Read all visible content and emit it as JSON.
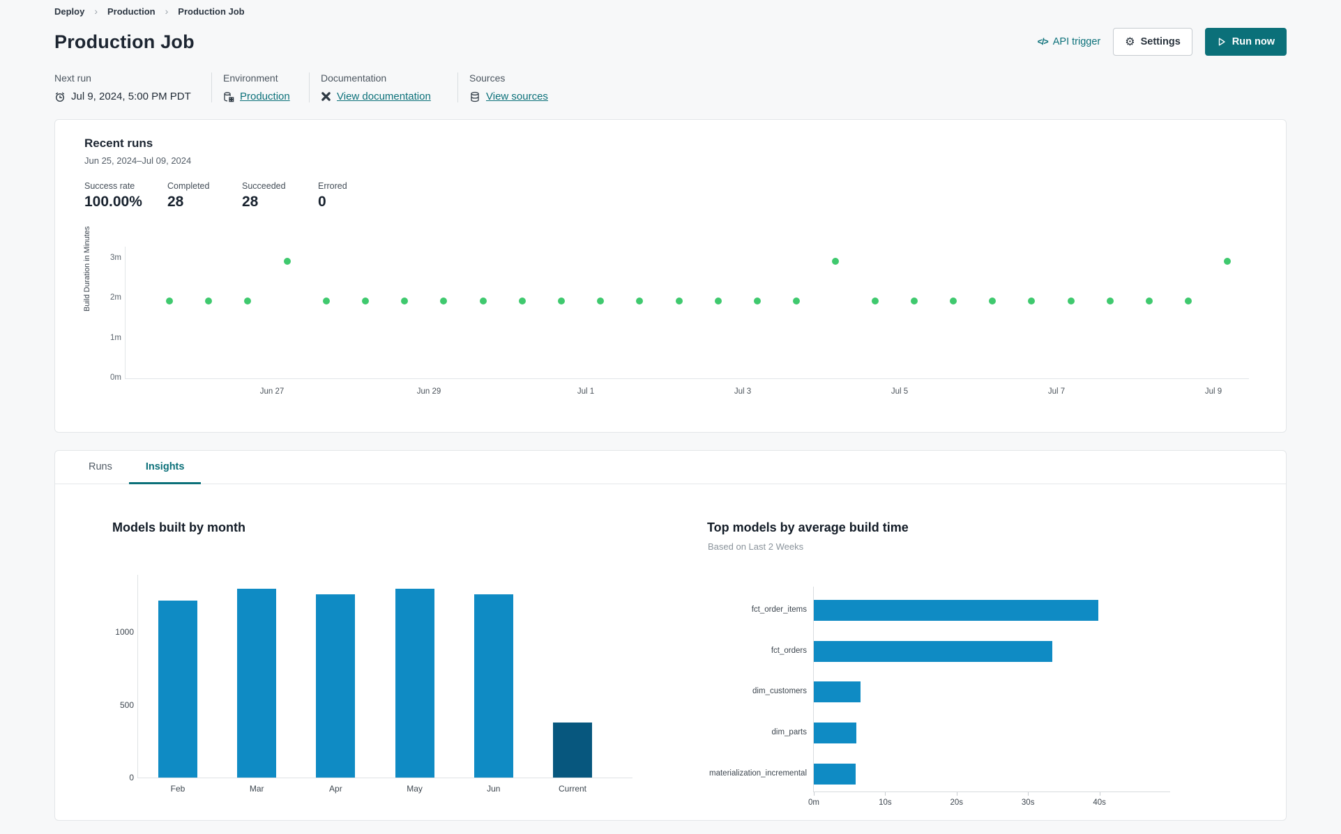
{
  "breadcrumb": {
    "separator": "›",
    "items": [
      "Deploy",
      "Production",
      "Production Job"
    ]
  },
  "header": {
    "title": "Production Job",
    "api_trigger_label": "API trigger",
    "settings_label": "Settings",
    "run_now_label": "Run now"
  },
  "icons": {
    "code_glyph": "</>",
    "gear_glyph": "⚙"
  },
  "meta": {
    "columns": [
      {
        "label": "Next run",
        "value": "Jul 9, 2024, 5:00 PM PDT",
        "icon": "clock-icon"
      },
      {
        "label": "Environment",
        "value": "Production",
        "icon": "environment-icon"
      },
      {
        "label": "Documentation",
        "value": "View documentation",
        "icon": "dbt-docs-icon"
      },
      {
        "label": "Sources",
        "value": "View sources",
        "icon": "database-icon"
      }
    ]
  },
  "recent_runs": {
    "title": "Recent runs",
    "date_range": "Jun 25, 2024–Jul 09, 2024",
    "stats": [
      {
        "label": "Success rate",
        "value": "100.00%"
      },
      {
        "label": "Completed",
        "value": "28"
      },
      {
        "label": "Succeeded",
        "value": "28"
      },
      {
        "label": "Errored",
        "value": "0"
      }
    ],
    "chart": {
      "type": "scatter",
      "ylabel": "Build Duration in Minutes",
      "y_ticks": [
        "0m",
        "1m",
        "2m",
        "3m"
      ],
      "ylim": [
        0,
        3.3
      ],
      "x_labels": [
        "Jun 27",
        "Jun 29",
        "Jul 1",
        "Jul 3",
        "Jul 5",
        "Jul 7",
        "Jul 9"
      ],
      "point_color": "#3fc96e",
      "durations_minutes": [
        1.95,
        1.95,
        1.95,
        2.95,
        1.95,
        1.95,
        1.95,
        1.95,
        1.95,
        1.95,
        1.95,
        1.95,
        1.95,
        1.95,
        1.95,
        1.95,
        1.95,
        2.95,
        1.95,
        1.95,
        1.95,
        1.95,
        1.95,
        1.95,
        1.95,
        1.95,
        1.95,
        2.95
      ]
    }
  },
  "tabs": [
    {
      "label": "Runs",
      "active": false
    },
    {
      "label": "Insights",
      "active": true
    }
  ],
  "insights": {
    "models_by_month": {
      "type": "bar",
      "title": "Models built by month",
      "categories": [
        "Feb",
        "Mar",
        "Apr",
        "May",
        "Jun",
        "Current"
      ],
      "values": [
        1220,
        1300,
        1260,
        1300,
        1260,
        380
      ],
      "y_ticks": [
        0,
        500,
        1000
      ],
      "ylim": [
        0,
        1400
      ],
      "bar_color": "#0f8bc4",
      "highlight_color": "#07577e",
      "highlight_index": 5
    },
    "top_models": {
      "type": "bar-horizontal",
      "title": "Top models by average build time",
      "subtitle": "Based on Last 2 Weeks",
      "categories": [
        "fct_order_items",
        "fct_orders",
        "dim_customers",
        "dim_parts",
        "materialization_incremental"
      ],
      "values_seconds": [
        39.8,
        33.4,
        6.5,
        6.0,
        5.9
      ],
      "x_ticks": [
        "0m",
        "10s",
        "20s",
        "30s",
        "40s"
      ],
      "xlim": [
        0,
        43
      ],
      "bar_color": "#0f8bc4"
    }
  },
  "colors": {
    "accent_teal": "#0b7079",
    "success_green": "#3fc96e",
    "bar_blue": "#0f8bc4",
    "bar_navy": "#07577e"
  }
}
